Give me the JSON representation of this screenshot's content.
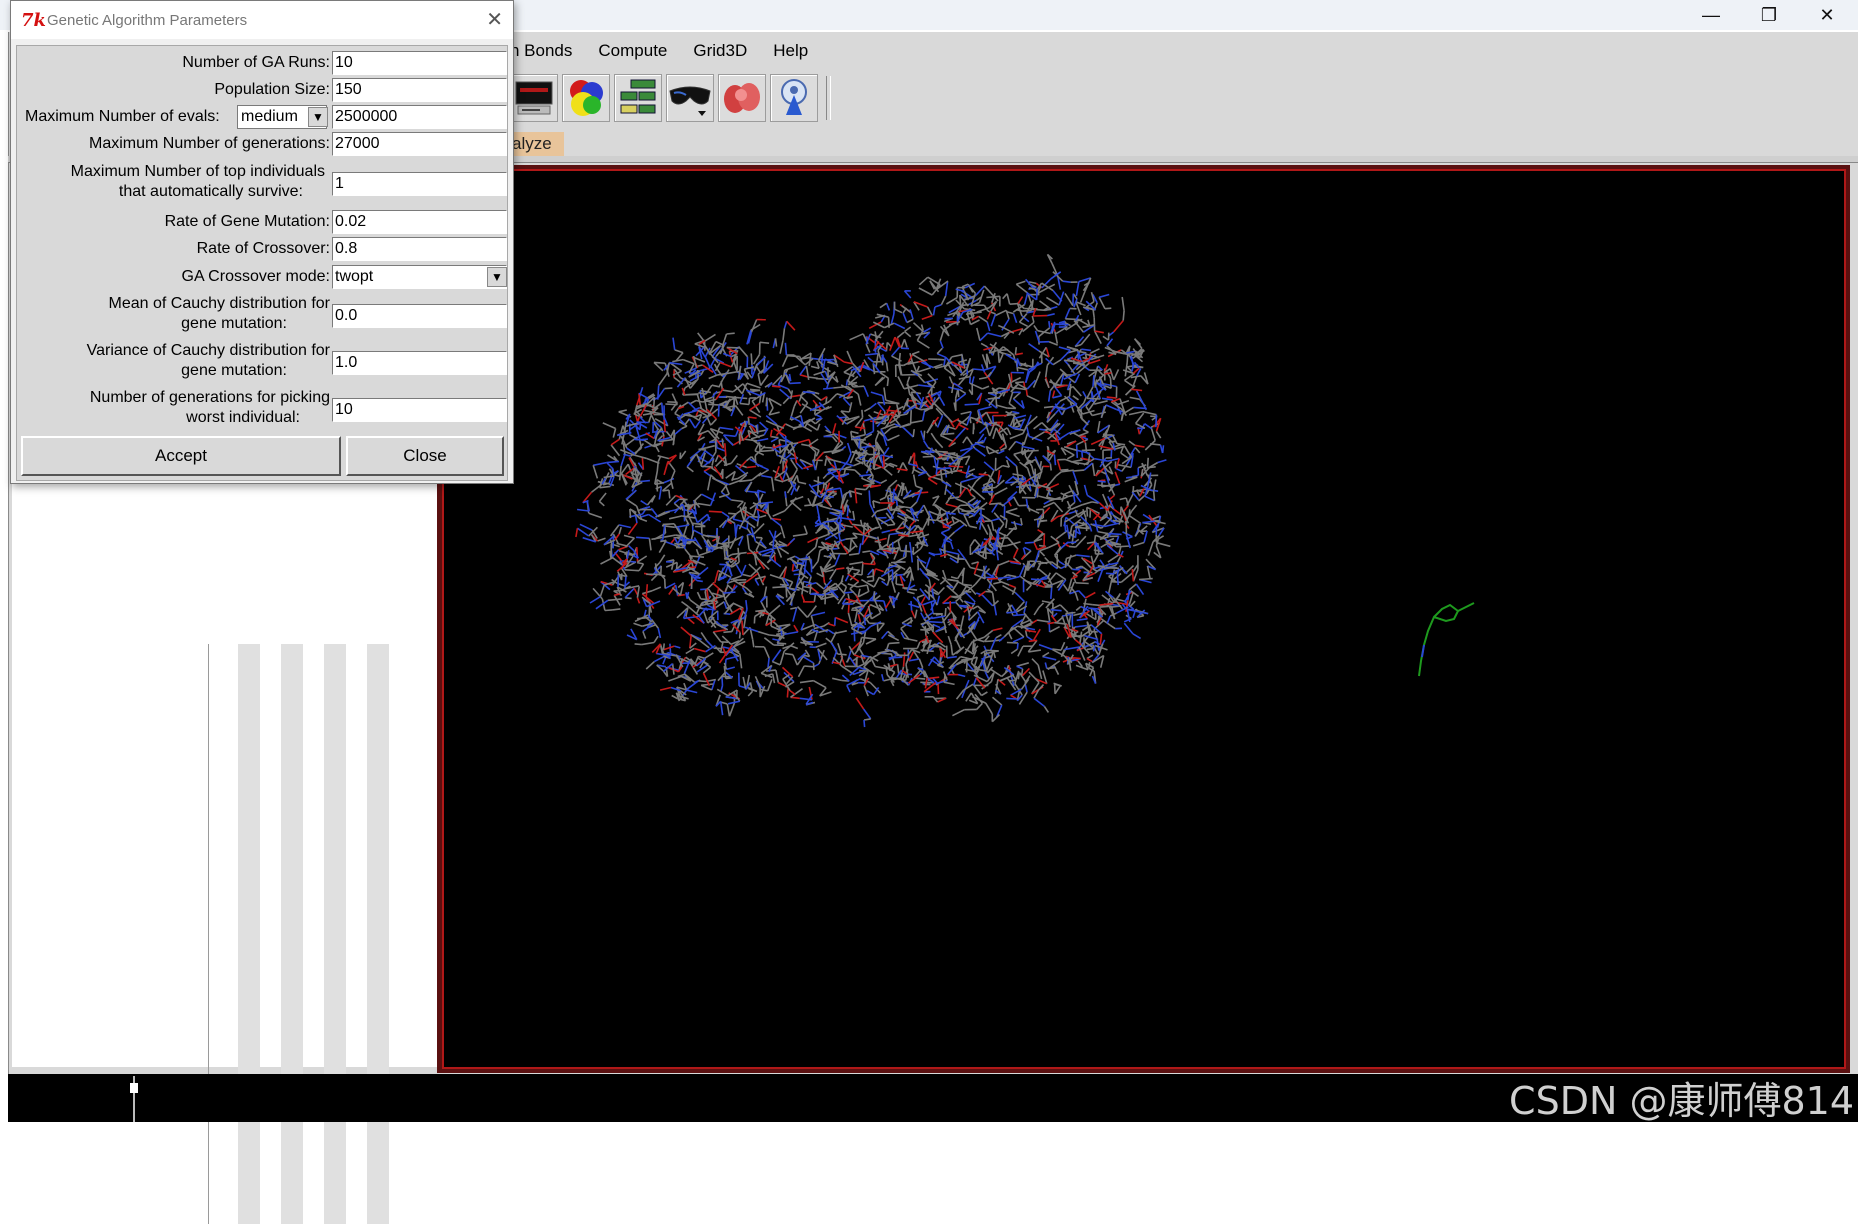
{
  "dialog": {
    "title": "Genetic Algorithm Parameters",
    "close_glyph": "✕",
    "fields": {
      "ga_runs": {
        "label": "Number of GA Runs:",
        "value": "10"
      },
      "population_size": {
        "label": "Population Size:",
        "value": "150"
      },
      "max_evals": {
        "label": "Maximum Number of evals:",
        "preset": "medium",
        "value": "2500000"
      },
      "max_generations": {
        "label": "Maximum Number of generations:",
        "value": "27000"
      },
      "top_individuals": {
        "label_line1": "Maximum Number of top individuals",
        "label_line2": "that automatically survive:",
        "value": "1"
      },
      "gene_mutation": {
        "label": "Rate of Gene Mutation:",
        "value": "0.02"
      },
      "crossover_rate": {
        "label": "Rate of Crossover:",
        "value": "0.8"
      },
      "crossover_mode": {
        "label": "GA Crossover mode:",
        "value": "twopt"
      },
      "cauchy_mean": {
        "label_line1": "Mean of Cauchy distribution for",
        "label_line2": "gene mutation:",
        "value": "0.0"
      },
      "cauchy_variance": {
        "label_line1": "Variance of Cauchy distribution for",
        "label_line2": "gene mutation:",
        "value": "1.0"
      },
      "worst_generations": {
        "label_line1": "Number of generations for picking",
        "label_line2": "worst individual:",
        "value": "10"
      }
    },
    "accept_label": "Accept",
    "close_label": "Close",
    "dropdown_arrow": "▼"
  },
  "window": {
    "minimize_glyph": "—",
    "restore_glyph": "❐",
    "close_glyph": "✕"
  },
  "menu": {
    "items": [
      "n Bonds",
      "Compute",
      "Grid3D",
      "Help"
    ]
  },
  "tabs": {
    "analyze_partial": "alyze"
  },
  "watermark": "CSDN @康师傅814",
  "colors": {
    "viewer_border": "#b01818",
    "protein_bonds": "#7a7a7a",
    "nitrogen": "#2a46d6",
    "oxygen": "#c41a1a",
    "ligand": "#1e9a1e",
    "tab_highlight": "#e8c49a"
  }
}
